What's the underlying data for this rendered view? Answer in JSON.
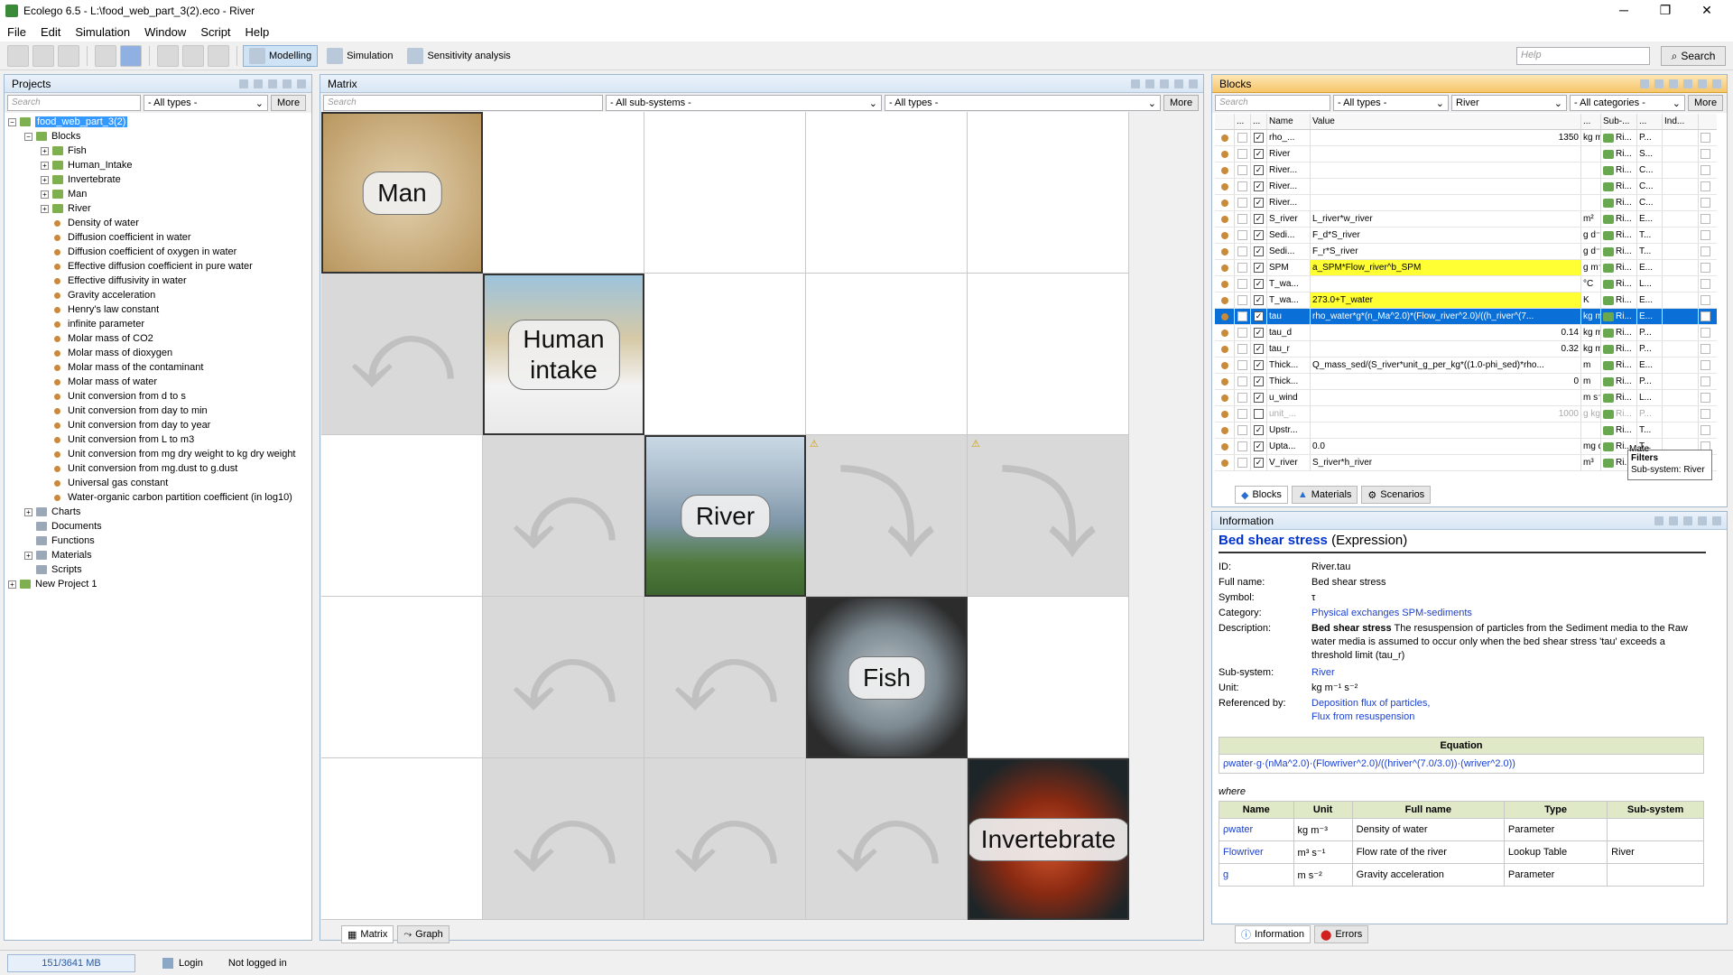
{
  "window": {
    "title": "Ecolego 6.5 - L:\\food_web_part_3(2).eco - River",
    "min": "─",
    "max": "❐",
    "close": "✕"
  },
  "menu": [
    "File",
    "Edit",
    "Simulation",
    "Window",
    "Script",
    "Help"
  ],
  "toolbar": {
    "modes": [
      "Modelling",
      "Simulation",
      "Sensitivity analysis"
    ],
    "help_placeholder": "Help",
    "search_label": "Search"
  },
  "projects": {
    "title": "Projects",
    "search_placeholder": "Search",
    "type_filter": "- All types -",
    "more": "More",
    "tree": [
      {
        "label": "food_web_part_3(2)",
        "level": 0,
        "kind": "project",
        "exp": "−",
        "selected": true
      },
      {
        "label": "Blocks",
        "level": 1,
        "kind": "folder",
        "exp": "−"
      },
      {
        "label": "Fish",
        "level": 2,
        "kind": "folder",
        "exp": "+"
      },
      {
        "label": "Human_Intake",
        "level": 2,
        "kind": "folder",
        "exp": "+"
      },
      {
        "label": "Invertebrate",
        "level": 2,
        "kind": "folder",
        "exp": "+"
      },
      {
        "label": "Man",
        "level": 2,
        "kind": "folder",
        "exp": "+"
      },
      {
        "label": "River",
        "level": 2,
        "kind": "folder",
        "exp": "+"
      },
      {
        "label": "Density of water",
        "level": 2,
        "kind": "leaf"
      },
      {
        "label": "Diffusion coefficient in water",
        "level": 2,
        "kind": "leaf"
      },
      {
        "label": "Diffusion coefficient of oxygen in water",
        "level": 2,
        "kind": "leaf"
      },
      {
        "label": "Effective diffusion coefficient in pure water",
        "level": 2,
        "kind": "leaf"
      },
      {
        "label": "Effective diffusivity in water",
        "level": 2,
        "kind": "leaf"
      },
      {
        "label": "Gravity acceleration",
        "level": 2,
        "kind": "leaf"
      },
      {
        "label": "Henry's law constant",
        "level": 2,
        "kind": "leaf"
      },
      {
        "label": "infinite parameter",
        "level": 2,
        "kind": "leaf"
      },
      {
        "label": "Molar mass of CO2",
        "level": 2,
        "kind": "leaf"
      },
      {
        "label": "Molar mass of dioxygen",
        "level": 2,
        "kind": "leaf"
      },
      {
        "label": "Molar mass of the contaminant",
        "level": 2,
        "kind": "leaf"
      },
      {
        "label": "Molar mass of water",
        "level": 2,
        "kind": "leaf"
      },
      {
        "label": "Unit conversion from d to s",
        "level": 2,
        "kind": "leaf"
      },
      {
        "label": "Unit conversion from day to min",
        "level": 2,
        "kind": "leaf"
      },
      {
        "label": "Unit conversion from day to year",
        "level": 2,
        "kind": "leaf"
      },
      {
        "label": "Unit conversion from L to m3",
        "level": 2,
        "kind": "leaf"
      },
      {
        "label": "Unit conversion from mg dry weight to kg dry weight",
        "level": 2,
        "kind": "leaf"
      },
      {
        "label": "Unit conversion from mg.dust to g.dust",
        "level": 2,
        "kind": "leaf"
      },
      {
        "label": "Universal gas constant",
        "level": 2,
        "kind": "leaf"
      },
      {
        "label": "Water-organic carbon partition coefficient (in log10)",
        "level": 2,
        "kind": "leaf"
      },
      {
        "label": "Charts",
        "level": 1,
        "kind": "group",
        "exp": "+"
      },
      {
        "label": "Documents",
        "level": 1,
        "kind": "group"
      },
      {
        "label": "Functions",
        "level": 1,
        "kind": "group"
      },
      {
        "label": "Materials",
        "level": 1,
        "kind": "group",
        "exp": "+"
      },
      {
        "label": "Scripts",
        "level": 1,
        "kind": "group"
      },
      {
        "label": "New Project 1",
        "level": 0,
        "kind": "project",
        "exp": "+"
      }
    ]
  },
  "matrix": {
    "title": "Matrix",
    "search_placeholder": "Search",
    "subsystem_filter": "- All sub-systems -",
    "type_filter": "- All types -",
    "more": "More",
    "compartments": [
      "Man",
      "Human\nintake",
      "River",
      "Fish",
      "Invertebrate"
    ],
    "tabs": [
      "Matrix",
      "Graph"
    ]
  },
  "blocks": {
    "title": "Blocks",
    "search_placeholder": "Search",
    "type_filter": "- All types -",
    "subsystem": "River",
    "category_filter": "- All categories -",
    "more": "More",
    "headers": {
      "dots1": "...",
      "dots2": "...",
      "name": "Name",
      "value": "Value",
      "dots3": "...",
      "sub": "Sub-...",
      "dots4": "...",
      "ind": "Ind..."
    },
    "rows": [
      {
        "name": "rho_...",
        "value": "",
        "num": "1350",
        "unit": "kg m",
        "sub": "Ri...",
        "cat": "P..."
      },
      {
        "name": "River",
        "value": "",
        "num": "",
        "unit": "",
        "sub": "Ri...",
        "cat": "S..."
      },
      {
        "name": "River...",
        "value": "",
        "num": "",
        "unit": "",
        "sub": "Ri...",
        "cat": "C..."
      },
      {
        "name": "River...",
        "value": "",
        "num": "",
        "unit": "",
        "sub": "Ri...",
        "cat": "C..."
      },
      {
        "name": "River...",
        "value": "",
        "num": "",
        "unit": "",
        "sub": "Ri...",
        "cat": "C..."
      },
      {
        "name": "S_river",
        "value": "L_river*w_river",
        "num": "",
        "unit": "m²",
        "sub": "Ri...",
        "cat": "E..."
      },
      {
        "name": "Sedi...",
        "value": "F_d*S_river",
        "num": "",
        "unit": "g d⁻¹",
        "sub": "Ri...",
        "cat": "T..."
      },
      {
        "name": "Sedi...",
        "value": "F_r*S_river",
        "num": "",
        "unit": "g d⁻¹",
        "sub": "Ri...",
        "cat": "T..."
      },
      {
        "name": "SPM",
        "value": "a_SPM*Flow_river^b_SPM",
        "num": "",
        "unit": "g m⁻³",
        "sub": "Ri...",
        "cat": "E...",
        "hl": true
      },
      {
        "name": "T_wa...",
        "value": "",
        "num": "",
        "unit": "°C",
        "sub": "Ri...",
        "cat": "L..."
      },
      {
        "name": "T_wa...",
        "value": "273.0+T_water",
        "num": "",
        "unit": "K",
        "sub": "Ri...",
        "cat": "E...",
        "hl": true
      },
      {
        "name": "tau",
        "value": "rho_water*g*(n_Ma^2.0)*(Flow_river^2.0)/((h_river^(7...",
        "num": "",
        "unit": "kg m",
        "sub": "Ri...",
        "cat": "E...",
        "cur": true
      },
      {
        "name": "tau_d",
        "value": "",
        "num": "0.14",
        "unit": "kg m",
        "sub": "Ri...",
        "cat": "P..."
      },
      {
        "name": "tau_r",
        "value": "",
        "num": "0.32",
        "unit": "kg m",
        "sub": "Ri...",
        "cat": "P..."
      },
      {
        "name": "Thick...",
        "value": "Q_mass_sed/(S_river*unit_g_per_kg*((1.0-phi_sed)*rho...",
        "num": "",
        "unit": "m",
        "sub": "Ri...",
        "cat": "E..."
      },
      {
        "name": "Thick...",
        "value": "",
        "num": "0",
        "unit": "m",
        "sub": "Ri...",
        "cat": "P..."
      },
      {
        "name": "u_wind",
        "value": "",
        "num": "",
        "unit": "m s⁻¹",
        "sub": "Ri...",
        "cat": "L..."
      },
      {
        "name": "unit_...",
        "value": "",
        "num": "1000",
        "unit": "g kg⁻¹",
        "sub": "Ri...",
        "cat": "P...",
        "off": true
      },
      {
        "name": "Upstr...",
        "value": "",
        "num": "",
        "unit": "",
        "sub": "Ri...",
        "cat": "T..."
      },
      {
        "name": "Upta...",
        "value": "0.0",
        "num": "",
        "unit": "mg d",
        "sub": "Ri...",
        "cat": "T..."
      },
      {
        "name": "V_river",
        "value": "S_river*h_river",
        "num": "",
        "unit": "m³",
        "sub": "Ri...",
        "cat": "E..."
      }
    ],
    "tooltip": {
      "title": "Filters",
      "text": "Sub-system: River",
      "under": "Mate"
    },
    "tabs": [
      "Blocks",
      "Materials",
      "Scenarios"
    ]
  },
  "info": {
    "title": "Information",
    "block_name": "Bed shear stress",
    "block_type": "(Expression)",
    "fields": [
      {
        "label": "ID:",
        "value": "River.tau"
      },
      {
        "label": "Full name:",
        "value": "Bed shear stress"
      },
      {
        "label": "Symbol:",
        "value": "τ"
      }
    ],
    "category_label": "Category:",
    "category": "Physical exchanges SPM-sediments",
    "description_label": "Description:",
    "description_bold": "Bed shear stress",
    "description": "The resuspension of particles from the Sediment media to the Raw water media is assumed to occur only when the bed shear stress 'tau' exceeds a threshold limit (tau_r)",
    "subsystem_label": "Sub-system:",
    "subsystem": "River",
    "unit_label": "Unit:",
    "unit": "kg m⁻¹ s⁻²",
    "refby_label": "Referenced by:",
    "refby": [
      "Deposition flux of particles,",
      "Flux from resuspension"
    ],
    "equation_header": "Equation",
    "equation": "ρwater·g·(nMa^2.0)·(Flowriver^2.0)/((hriver^(7.0/3.0))·(wriver^2.0))",
    "where": "where",
    "var_headers": [
      "Name",
      "Unit",
      "Full name",
      "Type",
      "Sub-system"
    ],
    "vars": [
      {
        "name": "ρwater",
        "unit": "kg m⁻³",
        "full": "Density of water",
        "type": "Parameter",
        "sub": ""
      },
      {
        "name": "Flowriver",
        "unit": "m³ s⁻¹",
        "full": "Flow rate of the river",
        "type": "Lookup Table",
        "sub": "River"
      },
      {
        "name": "g",
        "unit": "m s⁻²",
        "full": "Gravity acceleration",
        "type": "Parameter",
        "sub": ""
      }
    ],
    "tabs": [
      "Information",
      "Errors"
    ]
  },
  "status": {
    "memory": "151/3641 MB",
    "login": "Login",
    "login_state": "Not logged in"
  }
}
